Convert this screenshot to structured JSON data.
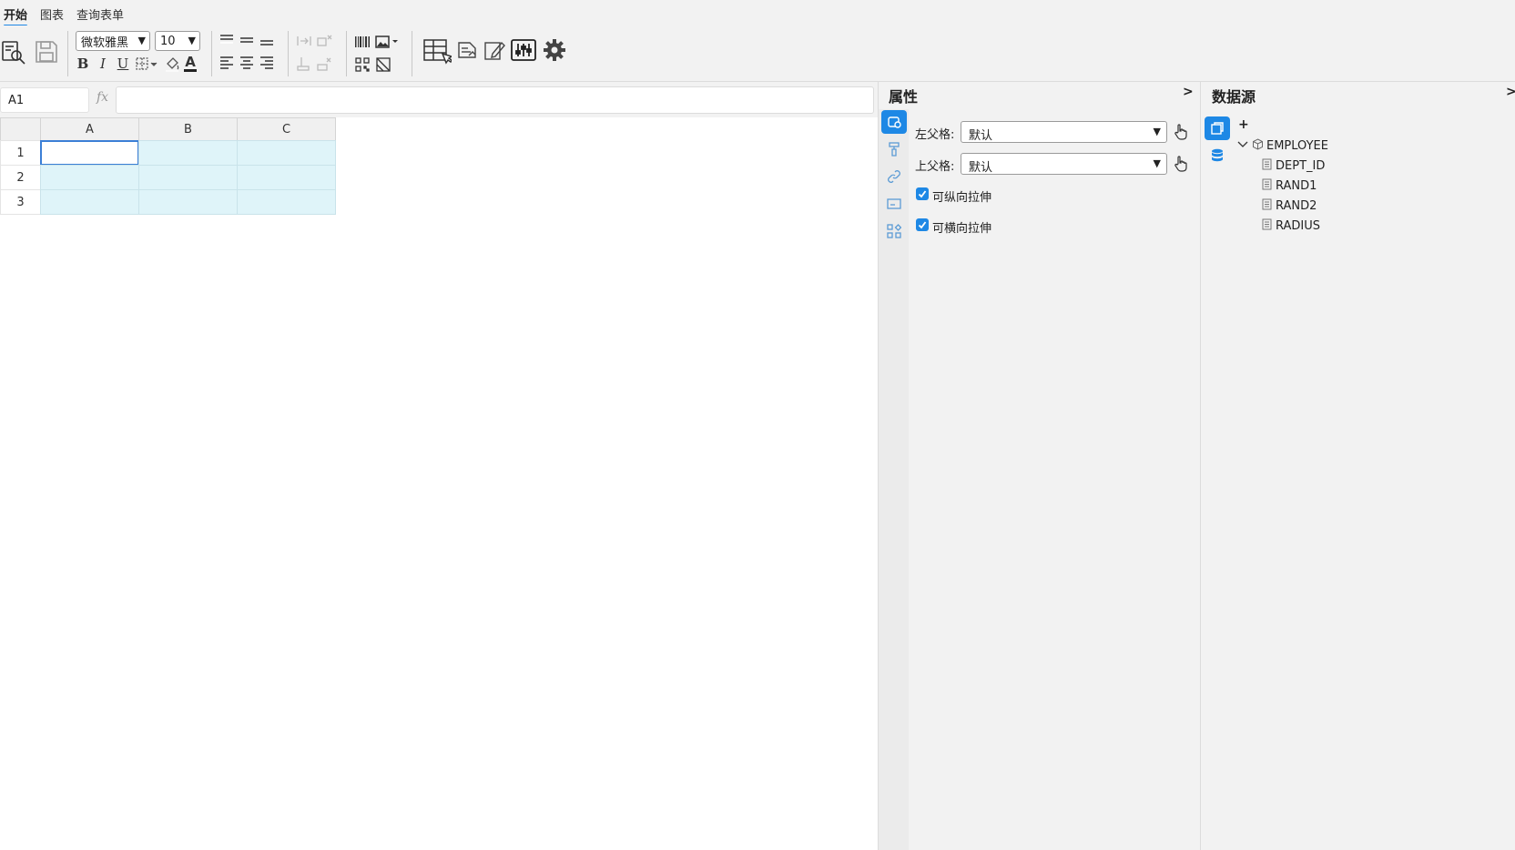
{
  "menu": {
    "tabs": [
      "开始",
      "图表",
      "查询表单"
    ],
    "active_tab": "开始"
  },
  "toolbar": {
    "font_family": "微软雅黑",
    "font_size": "10",
    "bold": "B",
    "italic": "I",
    "underline": "U",
    "font_color_letter": "A"
  },
  "formula_bar": {
    "cell_ref": "A1",
    "fx": "fx",
    "formula": ""
  },
  "sheet": {
    "columns": [
      "A",
      "B",
      "C"
    ],
    "rows": [
      "1",
      "2",
      "3"
    ],
    "selected_cell": "A1"
  },
  "properties": {
    "title": "属性",
    "collapse": ">",
    "left_parent_label": "左父格:",
    "left_parent_value": "默认",
    "top_parent_label": "上父格:",
    "top_parent_value": "默认",
    "vertical_stretch_label": "可纵向拉伸",
    "vertical_stretch_checked": true,
    "horizontal_stretch_label": "可横向拉伸",
    "horizontal_stretch_checked": true
  },
  "datasource": {
    "title": "数据源",
    "collapse": ">",
    "add": "+",
    "dataset": "EMPLOYEE",
    "fields": [
      "DEPT_ID",
      "RAND1",
      "RAND2",
      "RADIUS"
    ]
  },
  "colors": {
    "accent": "#1e88e5",
    "cell_fill": "#dff4f9",
    "selection_border": "#3b7fd6"
  }
}
